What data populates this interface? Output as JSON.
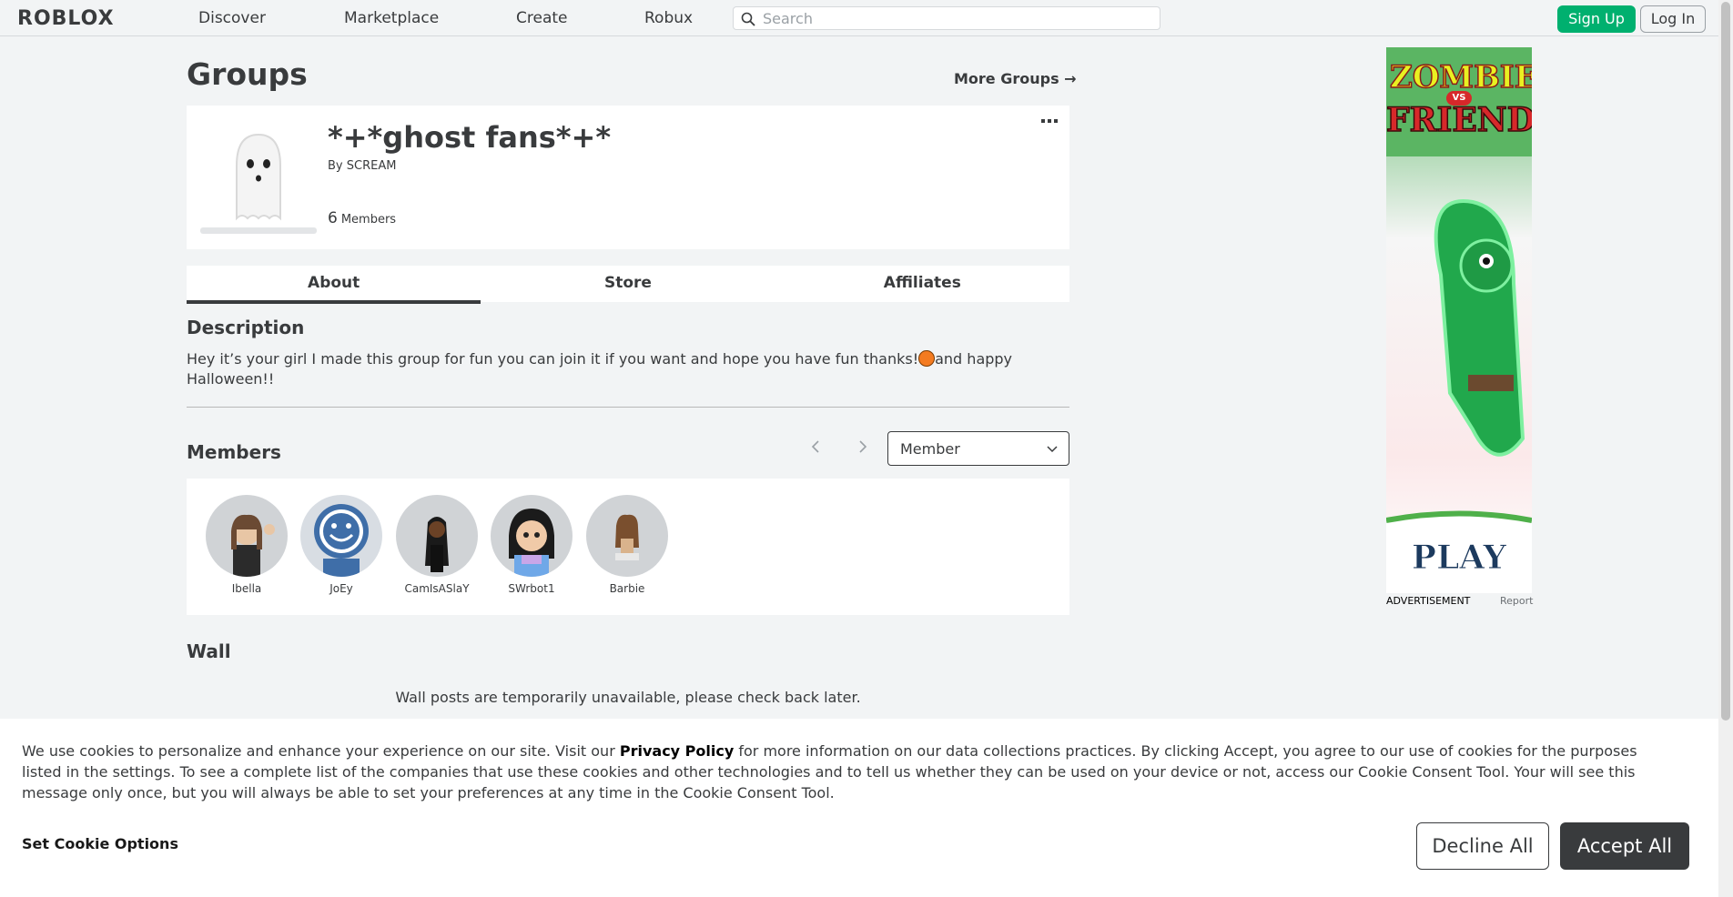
{
  "nav": {
    "logo": "ROBLOX",
    "links": [
      "Discover",
      "Marketplace",
      "Create",
      "Robux"
    ],
    "search_placeholder": "Search",
    "signup": "Sign Up",
    "login": "Log In"
  },
  "page": {
    "title": "Groups",
    "more_groups": "More Groups →"
  },
  "group": {
    "name": "*+*ghost fans*+*",
    "by_label": "By",
    "owner": "SCREAM",
    "member_count": "6",
    "member_label": "Members"
  },
  "tabs": [
    {
      "label": "About",
      "active": true
    },
    {
      "label": "Store",
      "active": false
    },
    {
      "label": "Affiliates",
      "active": false
    }
  ],
  "description": {
    "title": "Description",
    "text_before": "Hey it’s your girl I made this group for fun you can join it if you want and hope you have fun thanks!",
    "text_after": "and happy Halloween!!"
  },
  "members": {
    "title": "Members",
    "role_selected": "Member",
    "list": [
      "Ibella",
      "JoEy",
      "CamIsASlaY",
      "SWrbot1",
      "Barbie"
    ]
  },
  "wall": {
    "title": "Wall",
    "message": "Wall posts are temporarily unavailable, please check back later."
  },
  "ad": {
    "label": "ADVERTISEMENT",
    "report": "Report",
    "headline_top": "ZOMBIE",
    "headline_vs": "VS",
    "headline_bottom": "FRIEND",
    "cta": "PLAY"
  },
  "cookie": {
    "text_pre": "We use cookies to personalize and enhance your experience on our site. Visit our ",
    "privacy_link": "Privacy Policy",
    "text_post": " for more information on our data collections practices. By clicking Accept, you agree to our use of cookies for the purposes listed in the settings. To see a complete list of the companies that use these cookies and other technologies and to tell us whether they can be used on your device or not, access our Cookie Consent Tool. Your will see this message only once, but you will always be able to set your preferences at any time in the Cookie Consent Tool.",
    "set_options": "Set Cookie Options",
    "decline": "Decline All",
    "accept": "Accept All"
  },
  "colors": {
    "accent_green": "#00b06f",
    "text_dark": "#393b3d",
    "background": "#f2f4f5"
  }
}
